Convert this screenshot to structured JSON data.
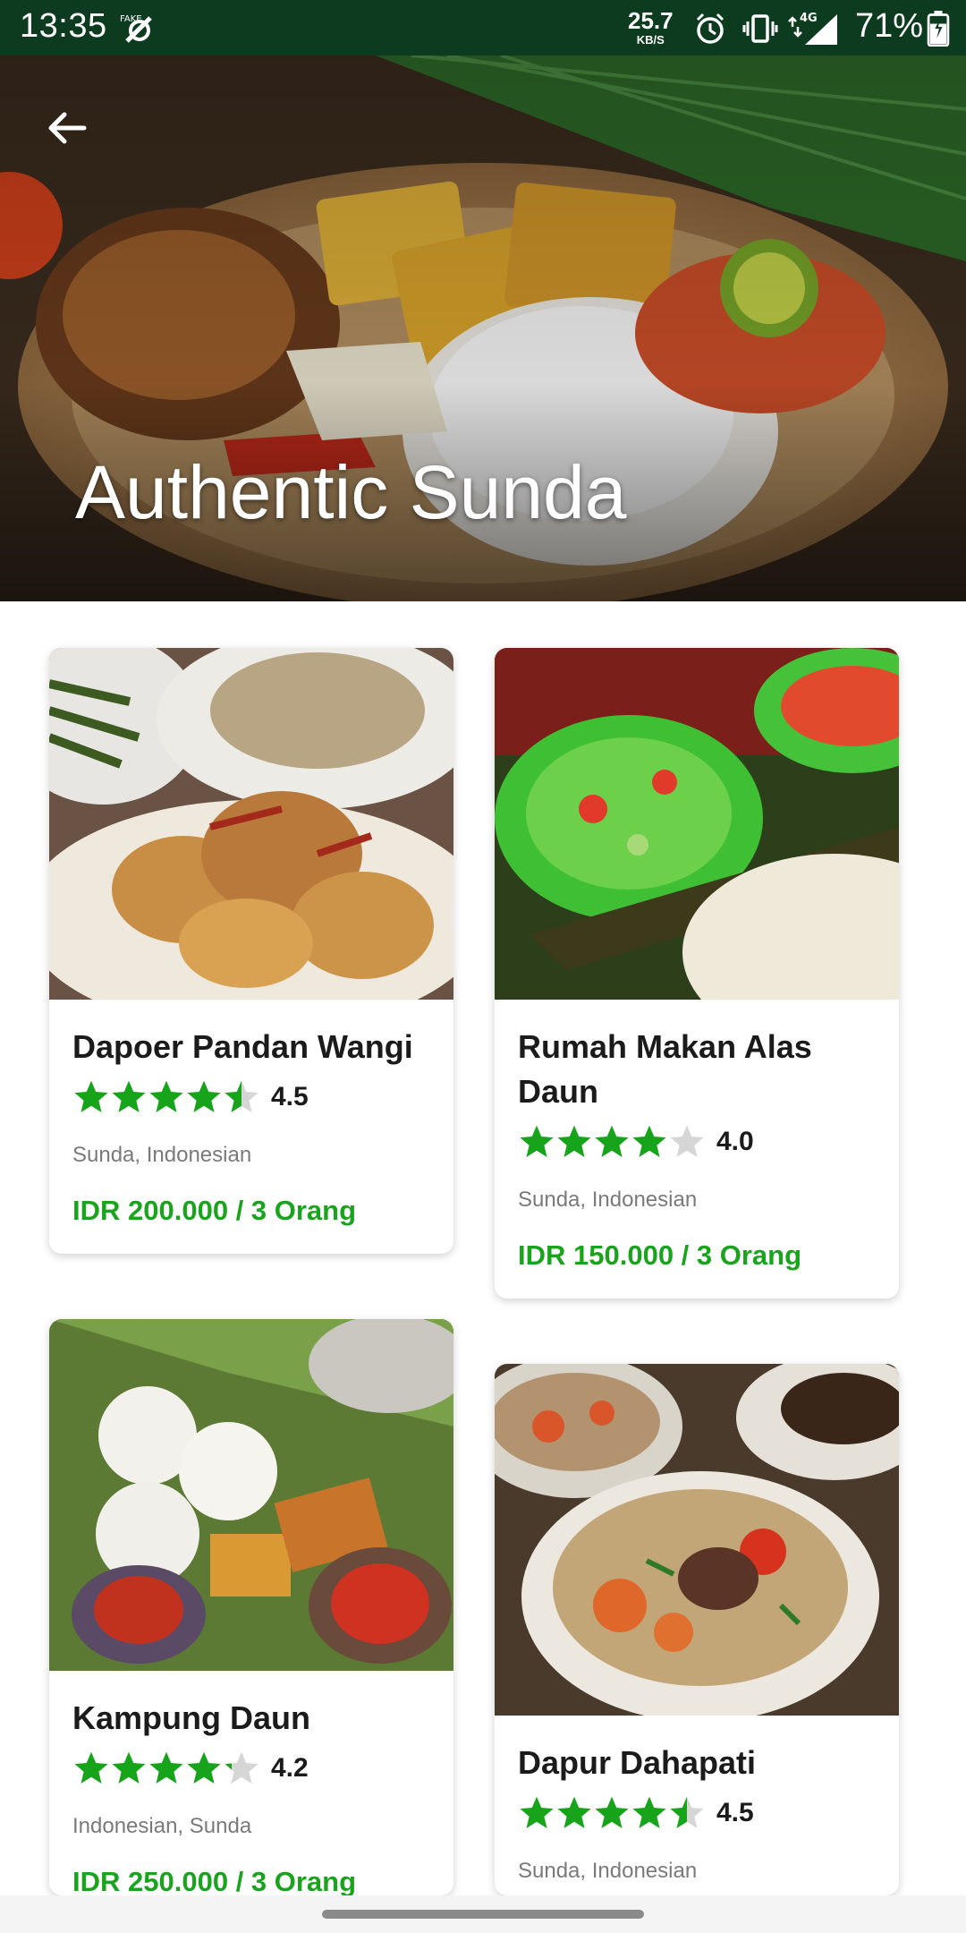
{
  "status_bar": {
    "time": "13:35",
    "speed_value": "25.7",
    "speed_unit": "KB/S",
    "network": "4G",
    "battery": "71%",
    "icons": [
      "fake-gps-icon",
      "alarm-icon",
      "vibrate-icon",
      "signal-icon",
      "battery-icon"
    ]
  },
  "header": {
    "title": "Authentic Sunda",
    "back_icon": "arrow-left-icon"
  },
  "colors": {
    "status_bar_bg": "#0d3b1f",
    "accent_green": "#1aa41d",
    "star_green": "#17a41a",
    "star_empty": "#d6d6d6"
  },
  "restaurants": [
    {
      "name": "Dapoer Pandan Wangi",
      "rating": "4.5",
      "rating_value": 4.5,
      "cuisine": "Sunda, Indonesian",
      "price": "IDR 200.000 / 3 Orang"
    },
    {
      "name": "Rumah Makan Alas Daun",
      "rating": "4.0",
      "rating_value": 4.0,
      "cuisine": "Sunda, Indonesian",
      "price": "IDR 150.000 / 3 Orang"
    },
    {
      "name": "Kampung Daun",
      "rating": "4.2",
      "rating_value": 4.2,
      "cuisine": "Indonesian, Sunda",
      "price": "IDR 250.000 / 3 Orang"
    },
    {
      "name": "Dapur Dahapati",
      "rating": "4.5",
      "rating_value": 4.5,
      "cuisine": "Sunda, Indonesian",
      "price": ""
    }
  ]
}
